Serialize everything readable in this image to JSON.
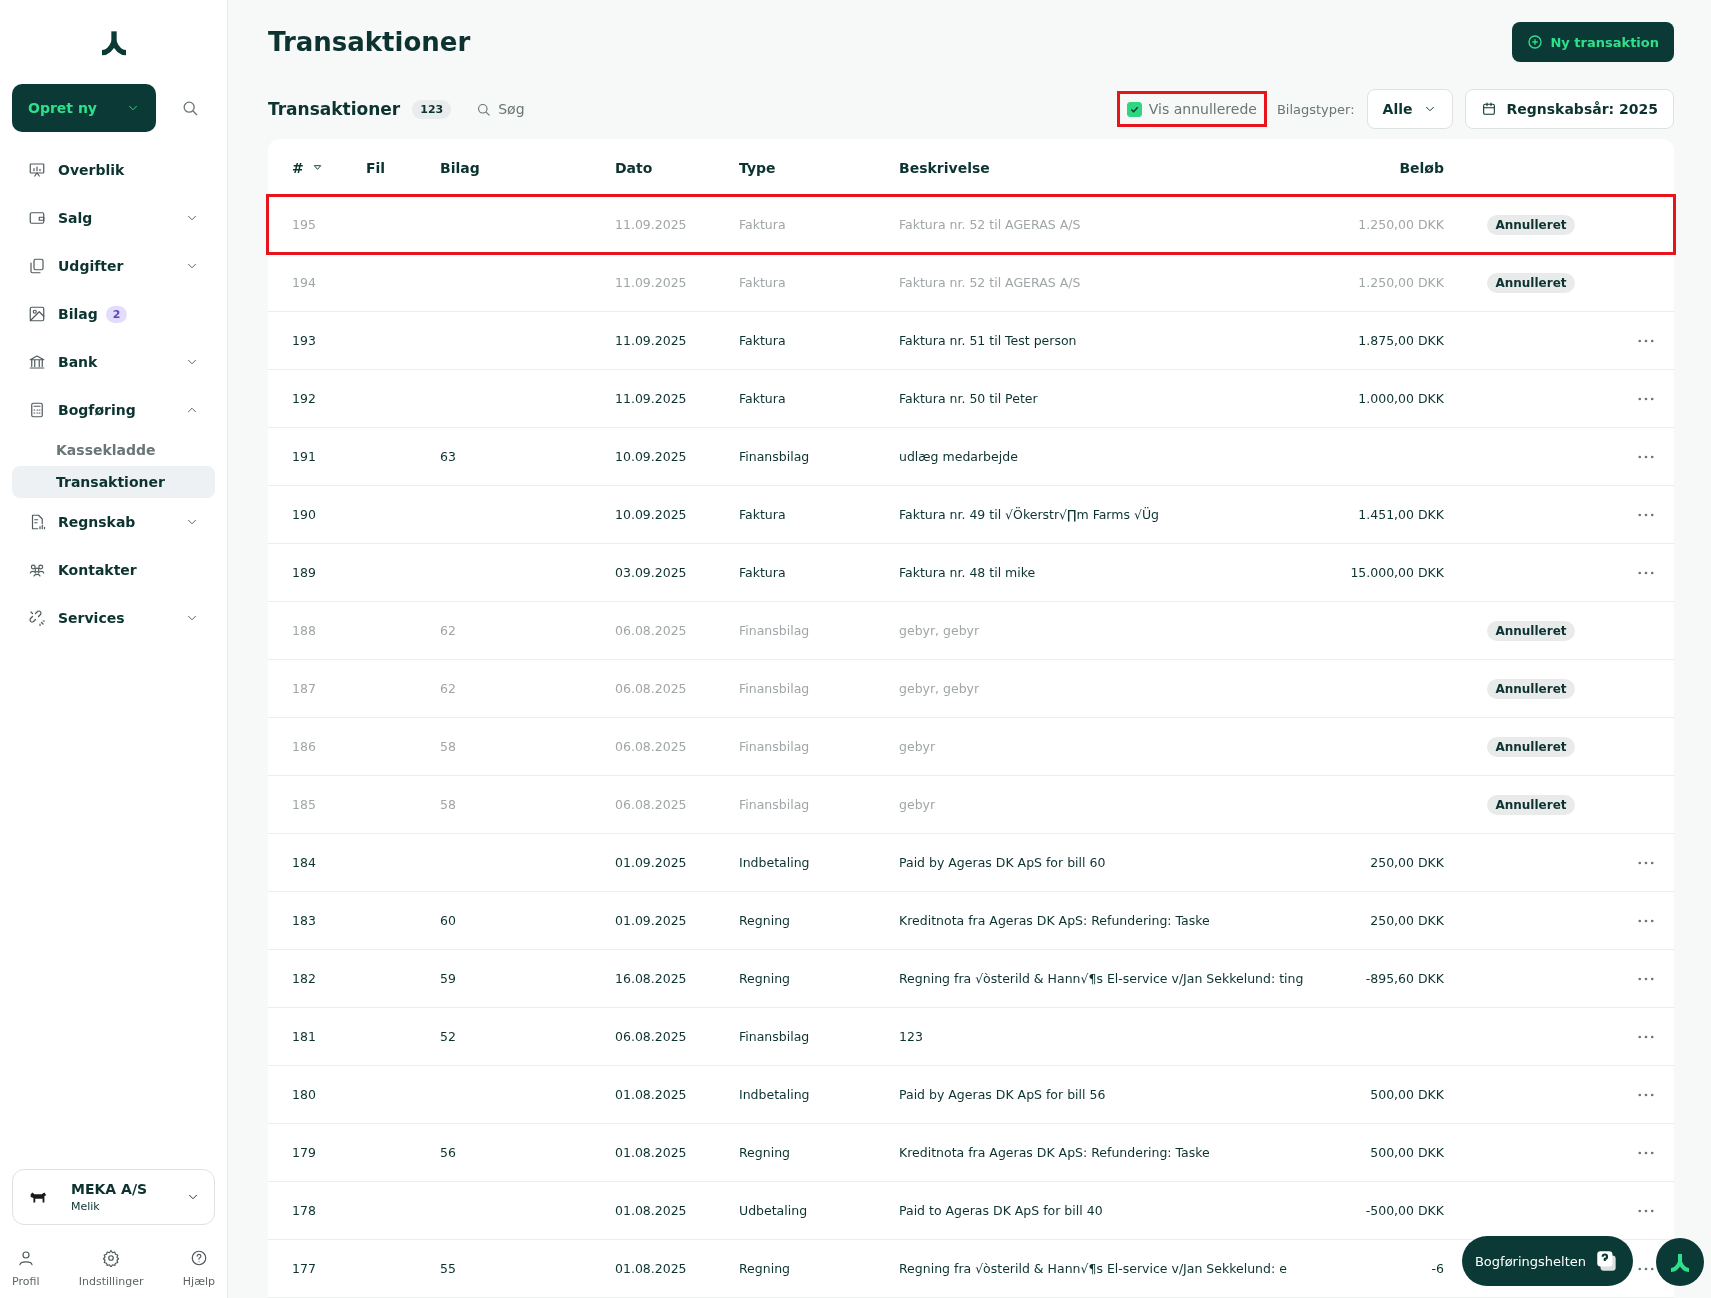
{
  "sidebar": {
    "create_button": "Opret ny",
    "items": [
      {
        "kind": "link",
        "label": "Overblik"
      },
      {
        "kind": "group",
        "label": "Salg",
        "expanded": false
      },
      {
        "kind": "group",
        "label": "Udgifter",
        "expanded": false
      },
      {
        "kind": "link",
        "label": "Bilag",
        "badge": "2"
      },
      {
        "kind": "group",
        "label": "Bank",
        "expanded": false
      },
      {
        "kind": "group",
        "label": "Bogføring",
        "expanded": true,
        "children": [
          {
            "label": "Kassekladde",
            "selected": false
          },
          {
            "label": "Transaktioner",
            "selected": true
          }
        ]
      },
      {
        "kind": "group",
        "label": "Regnskab",
        "expanded": false
      },
      {
        "kind": "link",
        "label": "Kontakter"
      },
      {
        "kind": "group",
        "label": "Services",
        "expanded": false
      }
    ],
    "company": {
      "name": "MEKA A/S",
      "user": "Melik"
    },
    "footer": [
      {
        "label": "Profil"
      },
      {
        "label": "Indstillinger"
      },
      {
        "label": "Hjælp"
      }
    ]
  },
  "page_title": "Transaktioner",
  "new_button": "Ny transaktion",
  "toolbar": {
    "title": "Transaktioner",
    "count": "123",
    "search_placeholder": "Søg",
    "show_cancelled": {
      "label": "Vis annullerede",
      "checked": true,
      "highlighted": true
    },
    "type_filter": {
      "label": "Bilagstyper:",
      "value": "Alle"
    },
    "year_button": "Regnskabsår: 2025"
  },
  "table": {
    "columns": [
      "#",
      "Fil",
      "Bilag",
      "Dato",
      "Type",
      "Beskrivelse",
      "Beløb"
    ],
    "rows": [
      {
        "number": "195",
        "date": "11.09.2025",
        "type": "Faktura",
        "description": "Faktura nr. 52 til AGERAS A/S",
        "amount": "1.250,00 DKK",
        "cancelled": true,
        "status": "Annulleret",
        "highlighted": true
      },
      {
        "number": "194",
        "date": "11.09.2025",
        "type": "Faktura",
        "description": "Faktura nr. 52 til AGERAS A/S",
        "amount": "1.250,00 DKK",
        "cancelled": true,
        "status": "Annulleret",
        "highlighted": false
      },
      {
        "number": "193",
        "date": "11.09.2025",
        "type": "Faktura",
        "description": "Faktura nr. 51 til Test person",
        "amount": "1.875,00 DKK",
        "cancelled": false,
        "highlighted": false
      },
      {
        "number": "192",
        "date": "11.09.2025",
        "type": "Faktura",
        "description": "Faktura nr. 50 til Peter",
        "amount": "1.000,00 DKK",
        "cancelled": false,
        "highlighted": false
      },
      {
        "number": "191",
        "voucher": "63",
        "date": "10.09.2025",
        "type": "Finansbilag",
        "description": "udlæg medarbejde",
        "cancelled": false,
        "highlighted": false
      },
      {
        "number": "190",
        "date": "10.09.2025",
        "type": "Faktura",
        "description": "Faktura nr. 49 til √Ökerstr√∏m Farms √Üg",
        "amount": "1.451,00 DKK",
        "cancelled": false,
        "highlighted": false
      },
      {
        "number": "189",
        "date": "03.09.2025",
        "type": "Faktura",
        "description": "Faktura nr. 48 til mike",
        "amount": "15.000,00 DKK",
        "cancelled": false,
        "highlighted": false
      },
      {
        "number": "188",
        "voucher": "62",
        "date": "06.08.2025",
        "type": "Finansbilag",
        "description": "gebyr, gebyr",
        "cancelled": true,
        "status": "Annulleret",
        "highlighted": false
      },
      {
        "number": "187",
        "voucher": "62",
        "date": "06.08.2025",
        "type": "Finansbilag",
        "description": "gebyr, gebyr",
        "cancelled": true,
        "status": "Annulleret",
        "highlighted": false
      },
      {
        "number": "186",
        "voucher": "58",
        "date": "06.08.2025",
        "type": "Finansbilag",
        "description": "gebyr",
        "cancelled": true,
        "status": "Annulleret",
        "highlighted": false
      },
      {
        "number": "185",
        "voucher": "58",
        "date": "06.08.2025",
        "type": "Finansbilag",
        "description": "gebyr",
        "cancelled": true,
        "status": "Annulleret",
        "highlighted": false
      },
      {
        "number": "184",
        "date": "01.09.2025",
        "type": "Indbetaling",
        "description": "Paid by Ageras DK ApS for bill 60",
        "amount": "250,00 DKK",
        "cancelled": false,
        "highlighted": false
      },
      {
        "number": "183",
        "voucher": "60",
        "date": "01.09.2025",
        "type": "Regning",
        "description": "Kreditnota fra Ageras DK ApS: Refundering: Taske",
        "amount": "250,00 DKK",
        "cancelled": false,
        "highlighted": false
      },
      {
        "number": "182",
        "voucher": "59",
        "date": "16.08.2025",
        "type": "Regning",
        "description": "Regning fra √òsterild & Hann√¶s El-service v/Jan Sekkelund: ting",
        "amount": "-895,60 DKK",
        "cancelled": false,
        "highlighted": false
      },
      {
        "number": "181",
        "voucher": "52",
        "date": "06.08.2025",
        "type": "Finansbilag",
        "description": "123",
        "cancelled": false,
        "highlighted": false
      },
      {
        "number": "180",
        "date": "01.08.2025",
        "type": "Indbetaling",
        "description": "Paid by Ageras DK ApS for bill 56",
        "amount": "500,00 DKK",
        "cancelled": false,
        "highlighted": false
      },
      {
        "number": "179",
        "voucher": "56",
        "date": "01.08.2025",
        "type": "Regning",
        "description": "Kreditnota fra Ageras DK ApS: Refundering: Taske",
        "amount": "500,00 DKK",
        "cancelled": false,
        "highlighted": false
      },
      {
        "number": "178",
        "date": "01.08.2025",
        "type": "Udbetaling",
        "description": "Paid to Ageras DK ApS for bill 40",
        "amount": "-500,00 DKK",
        "cancelled": false,
        "highlighted": false
      },
      {
        "number": "177",
        "voucher": "55",
        "date": "01.08.2025",
        "type": "Regning",
        "description": "Regning fra √òsterild & Hann√¶s El-service v/Jan Sekkelund: e",
        "amount": "-6",
        "cancelled": false,
        "highlighted": false
      }
    ]
  },
  "help_button": "Bogføringshelten"
}
